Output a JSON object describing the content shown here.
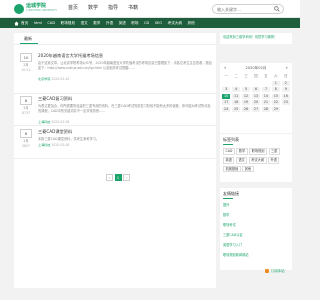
{
  "header": {
    "logo_title": "运城学院",
    "logo_subtitle": "YUNCHENG UNIVERSITY",
    "nav": [
      "首页",
      "数学",
      "指导",
      "书籍"
    ],
    "search_placeholder": "输入关键字..."
  },
  "catbar": {
    "items": [
      "首页",
      "html",
      "CAD",
      "职场规划",
      "语文",
      "数学",
      "外语",
      "英语",
      "职场",
      "CD",
      "SEO",
      "考试大纲",
      "其他"
    ]
  },
  "main": {
    "tab_label": "最新",
    "articles": [
      {
        "day": "10",
        "month": "2月",
        "time": "10:12",
        "title": "2020年越南语言大学托福考场信息",
        "summary": "由于这篇文章，让北京学院考场公众号，2020年越南语言大学托福考试的考场信息已整理如下，请各位考生注意查看。题目如下：http://www.nutrua.edu.vn/tgl.html 以及相关考试提醒……",
        "source": "北京学院",
        "date": "2020-02-10"
      },
      {
        "day": "8",
        "month": "2月",
        "time": "8737",
        "title": "三菱CAD复习资料",
        "summary": "为表达更加合，你所需要的自建的三菱专用的资料，在三菱CAD考试的前复习阶段不能有太多的误差，你可能对考试所涉及的课程，CAD中的关键词并不一定非常熟悉……",
        "source": "上海科技",
        "date": "2020-02-08"
      },
      {
        "day": "8",
        "month": "2月",
        "time": "3627",
        "title": "三菱CAD课堂资料",
        "summary": "本篇三菱CAD课堂资料，供考生参考学习。",
        "source": "上海科技",
        "date": "2020-02-08"
      }
    ],
    "pager": [
      "‹",
      "1",
      "›"
    ]
  },
  "side": {
    "notice": "欢迎来到三维学术网！祝您学习愉快！",
    "calendar": {
      "title": "2020年02月",
      "prev": "«",
      "next": "»",
      "weekdays": [
        "一",
        "二",
        "三",
        "四",
        "五",
        "六",
        "日"
      ],
      "days": [
        "",
        "",
        "",
        "",
        "",
        "1",
        "2",
        "3",
        "4",
        "5",
        "6",
        "7",
        "8",
        "9",
        "10",
        "11",
        "12",
        "13",
        "14",
        "15",
        "16",
        "17",
        "18",
        "19",
        "20",
        "21",
        "22",
        "23",
        "24",
        "25",
        "26",
        "27",
        "28",
        "29",
        ""
      ],
      "today": "10"
    },
    "tags_title": "标签列表",
    "tags": [
      "CAD",
      "数学",
      "职场规划",
      "三菱",
      "英语",
      "语文",
      "考试大纲",
      "外语",
      "机械基础",
      "其他"
    ],
    "links_title": "友情链接",
    "links": [
      "国外",
      "数学",
      "职场考试",
      "三菱CAD认证",
      "英语学习入门",
      "职场规划新闻网站"
    ],
    "rss": "订阅本站"
  },
  "colors": {
    "brand": "#1aa36a",
    "catbar": "#1e5e3c"
  }
}
